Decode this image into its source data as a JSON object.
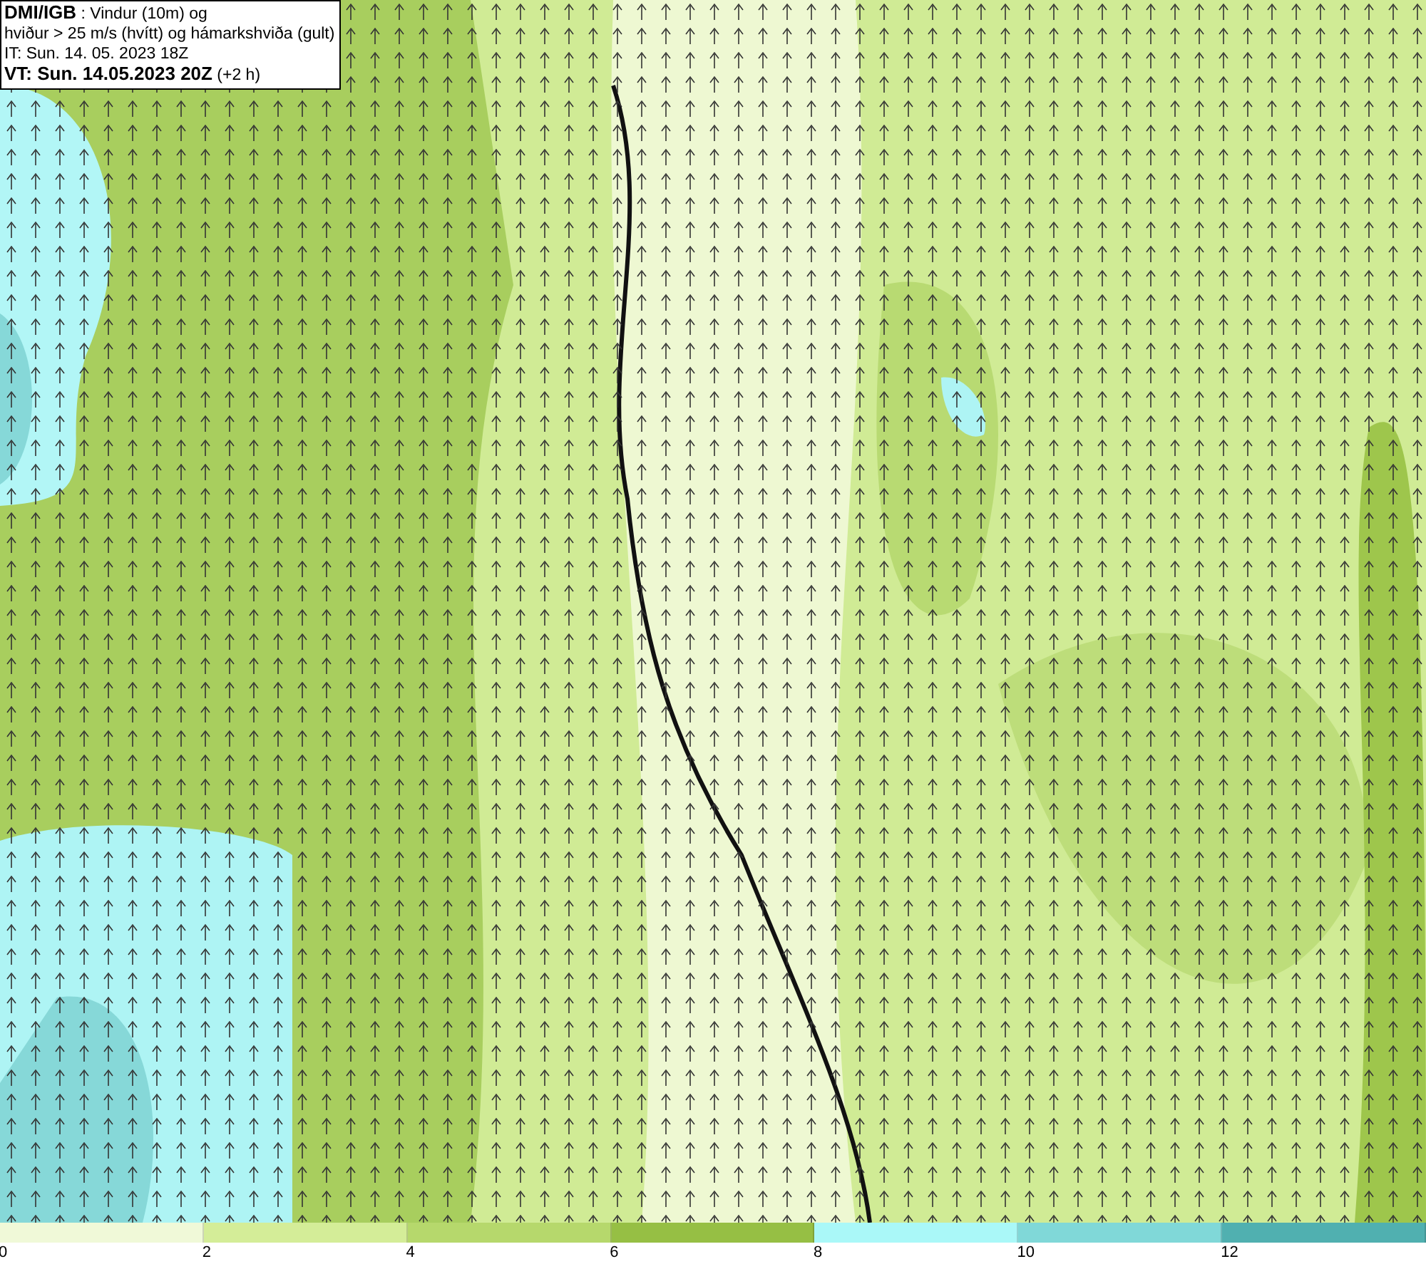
{
  "title_box": {
    "lines": [
      "**DMI/IGB** : Vindur (10m) og",
      "hviður > 25 m/s (hvítt) og hámarkshviða (gult)",
      "IT: Sun. 14. 05. 2023 18Z",
      "**VT: Sun. 14.05.2023 20Z** (+2 h)"
    ]
  },
  "legend": [
    {
      "label": "0",
      "color": "#f0f9d8"
    },
    {
      "label": "2",
      "color": "#d4ed98"
    },
    {
      "label": "4",
      "color": "#b6d86c"
    },
    {
      "label": "6",
      "color": "#96bf44"
    },
    {
      "label": "8",
      "color": "#aaf8f8"
    },
    {
      "label": "10",
      "color": "#80d8d8"
    },
    {
      "label": "12",
      "color": "#50b0b0"
    }
  ]
}
